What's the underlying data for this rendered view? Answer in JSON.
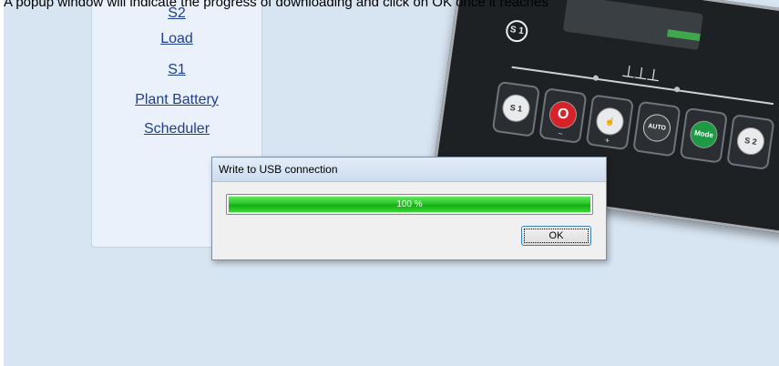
{
  "caption": "A popup window will indicate the progress of downloading and click on OK once it reaches",
  "nav": {
    "items": [
      "S2",
      "Load",
      "S1",
      "Plant Battery",
      "Scheduler"
    ]
  },
  "controller": {
    "mark_s1": "S 1",
    "buttons": [
      {
        "icon": "s1-breaker-icon",
        "label": "S 1",
        "sub": ""
      },
      {
        "icon": "stop-icon",
        "label": "O",
        "sub": "−"
      },
      {
        "icon": "hand-icon",
        "label": "☝",
        "sub": "+"
      },
      {
        "icon": "auto-icon",
        "label": "AUTO",
        "sub": ""
      },
      {
        "icon": "mode-icon",
        "label": "Mode",
        "sub": ""
      },
      {
        "icon": "s2-breaker-icon",
        "label": "S 2",
        "sub": ""
      }
    ]
  },
  "dialog": {
    "title": "Write to USB connection",
    "progress_value": 100,
    "progress_text": "100 %",
    "ok_label": "OK"
  }
}
